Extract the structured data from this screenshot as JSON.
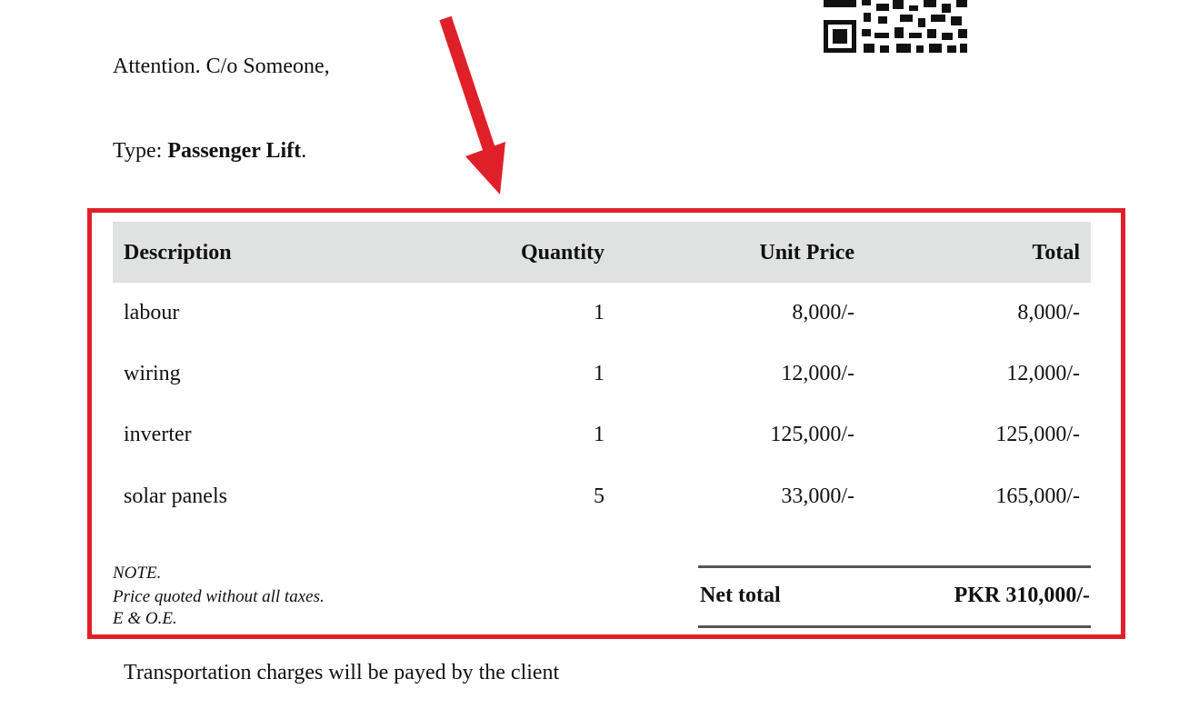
{
  "header": {
    "attention": "Attention. C/o Someone,",
    "type_prefix": "Type: ",
    "type_value": "Passenger Lift",
    "type_suffix": "."
  },
  "icons": {
    "qr": "qr-code-icon",
    "arrow": "red-arrow-icon"
  },
  "colors": {
    "highlight": "#e02028",
    "header_bg": "#e0e1e1"
  },
  "table": {
    "columns": [
      "Description",
      "Quantity",
      "Unit Price",
      "Total"
    ],
    "rows": [
      [
        "labour",
        "1",
        "8,000/-",
        "8,000/-"
      ],
      [
        "wiring",
        "1",
        "12,000/-",
        "12,000/-"
      ],
      [
        "inverter",
        "1",
        "125,000/-",
        "125,000/-"
      ],
      [
        "solar panels",
        "5",
        "33,000/-",
        "165,000/-"
      ]
    ]
  },
  "note": {
    "title": "NOTE.",
    "line1": "Price quoted without all taxes.",
    "line2": "E & O.E."
  },
  "net_total": {
    "label": "Net total",
    "value": "PKR 310,000/-"
  },
  "footer": {
    "transport": "Transportation charges will be payed by the client"
  }
}
